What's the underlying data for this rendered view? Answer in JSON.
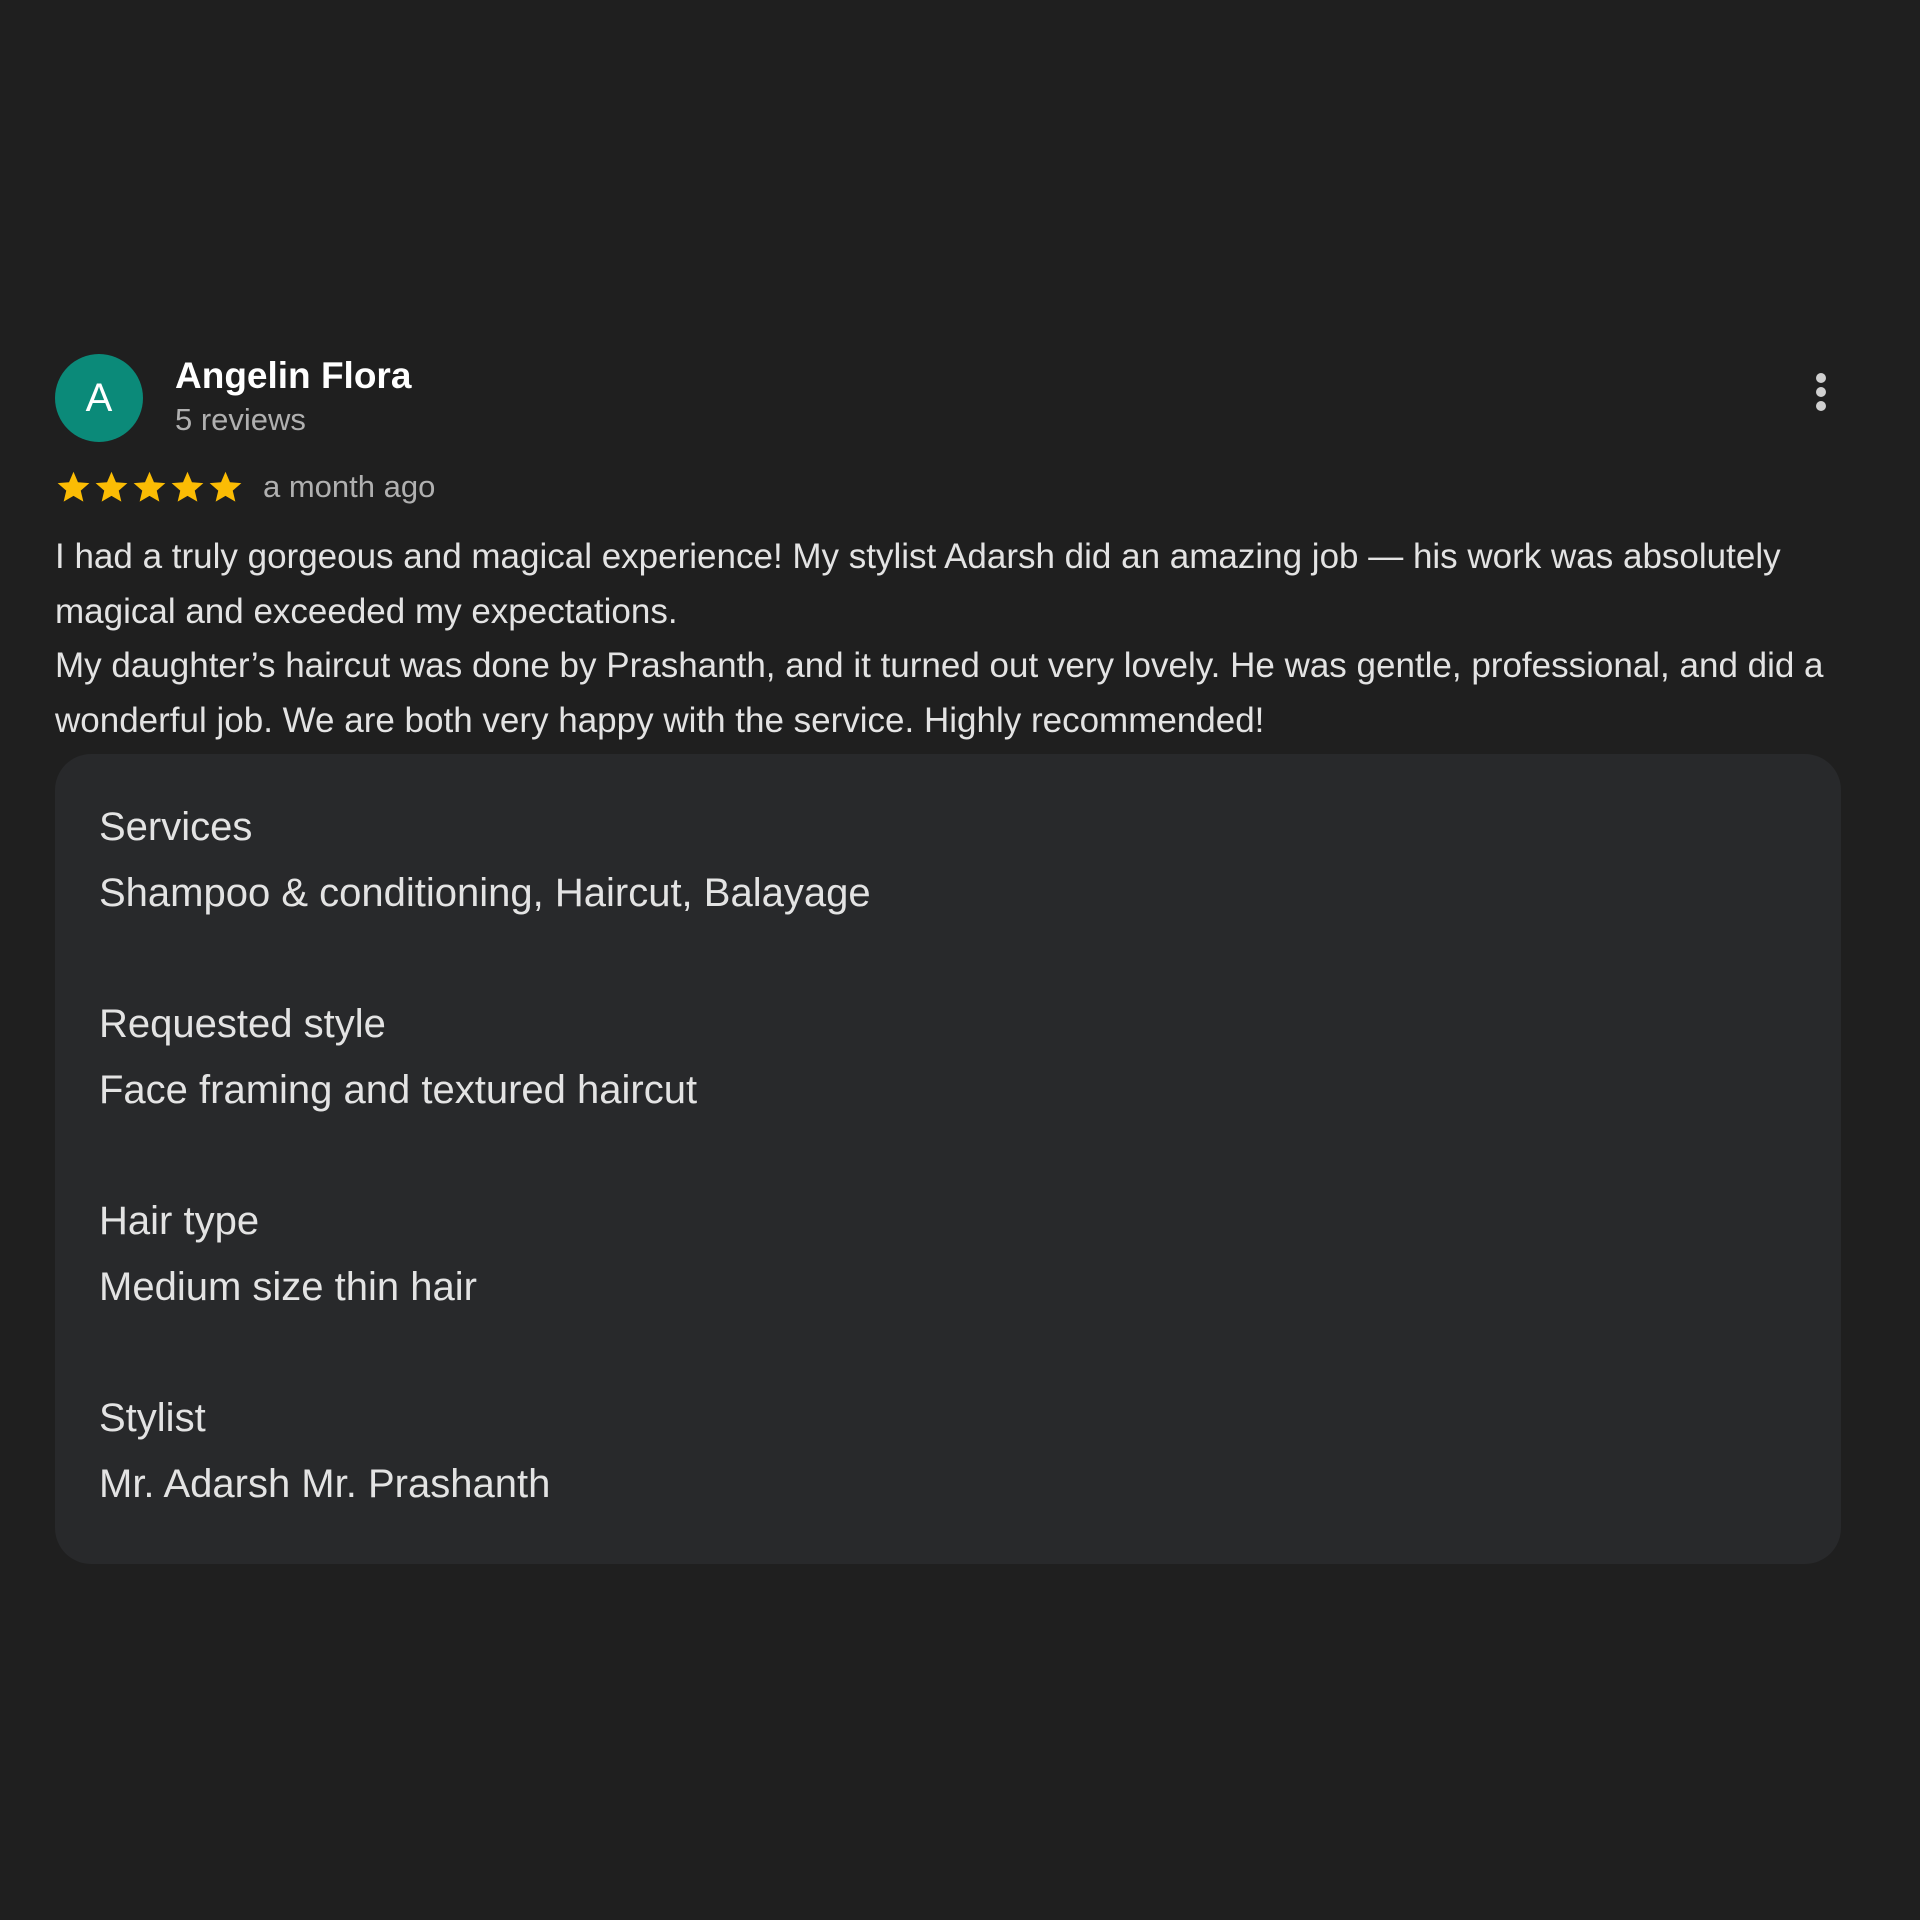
{
  "review": {
    "author": {
      "initial": "A",
      "name": "Angelin Flora",
      "review_count": "5 reviews",
      "avatar_color": "#0b8a79"
    },
    "more_options_icon": "vertical-dots-icon",
    "rating": 5,
    "rating_max": 5,
    "star_icon": "star-icon",
    "star_color": "#fbbc04",
    "timestamp": "a month ago",
    "text": [
      "I had a truly gorgeous and magical experience! My stylist Adarsh did an amazing job — his work was absolutely magical and exceeded my expectations.",
      "My daughter’s haircut was done by Prashanth, and it turned out very lovely. He was gentle, professional, and did a wonderful job. We are both very happy with the service. Highly recommended!"
    ]
  },
  "details": [
    {
      "label": "Services",
      "value": "Shampoo & conditioning, Haircut, Balayage"
    },
    {
      "label": "Requested style",
      "value": "Face framing and textured haircut"
    },
    {
      "label": "Hair type",
      "value": "Medium size thin hair"
    },
    {
      "label": "Stylist",
      "value": "Mr. Adarsh Mr. Prashanth"
    }
  ]
}
